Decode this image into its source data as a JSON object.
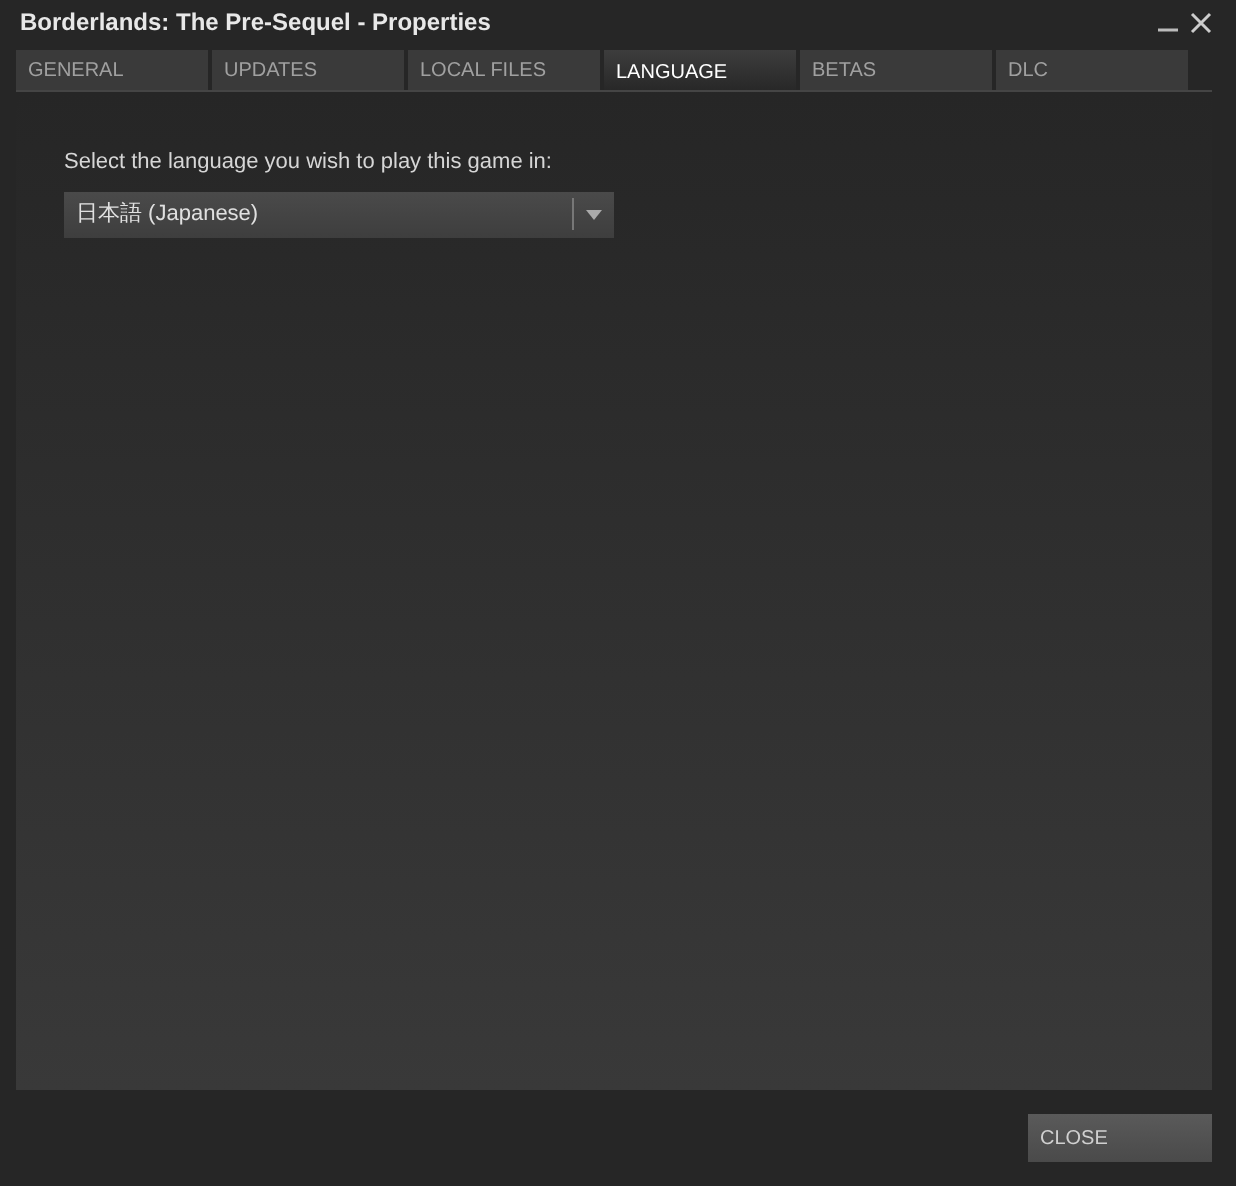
{
  "window": {
    "title": "Borderlands: The Pre-Sequel - Properties"
  },
  "tabs": [
    {
      "label": "GENERAL",
      "selected": false
    },
    {
      "label": "UPDATES",
      "selected": false
    },
    {
      "label": "LOCAL FILES",
      "selected": false
    },
    {
      "label": "LANGUAGE",
      "selected": true
    },
    {
      "label": "BETAS",
      "selected": false
    },
    {
      "label": "DLC",
      "selected": false
    }
  ],
  "language": {
    "prompt": "Select the language you wish to play this game in:",
    "value": "日本語 (Japanese)"
  },
  "buttons": [
    "CLOSE"
  ]
}
